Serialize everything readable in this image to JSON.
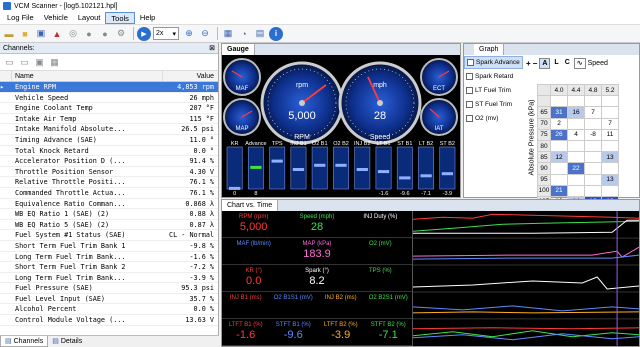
{
  "window": {
    "title": "VCM Scanner - [log5.102121.hpl]"
  },
  "menu": {
    "items": [
      "Log File",
      "Vehicle",
      "Layout",
      "Tools",
      "Help"
    ],
    "active": "Tools"
  },
  "toolbar": {
    "zoom": "2x"
  },
  "channels": {
    "title": "Channels:",
    "pin": " ✕",
    "col_name": "Name",
    "col_value": "Value",
    "rows": [
      {
        "name": "Engine RPM",
        "value": "4,853 rpm",
        "selected": true
      },
      {
        "name": "Vehicle Speed",
        "value": "26 mph"
      },
      {
        "name": "Engine Coolant Temp",
        "value": "207 °F"
      },
      {
        "name": "Intake Air Temp",
        "value": "115 °F"
      },
      {
        "name": "Intake Manifold Absolute...",
        "value": "26.5 psi"
      },
      {
        "name": "Timing Advance (SAE)",
        "value": "11.0 °"
      },
      {
        "name": "Total Knock Retard",
        "value": "0.0 °"
      },
      {
        "name": "Accelerator Position D (...",
        "value": "91.4 %"
      },
      {
        "name": "Throttle Position Sensor",
        "value": "4.30 V"
      },
      {
        "name": "Relative Throttle Positi...",
        "value": "76.1 %"
      },
      {
        "name": "Commanded Throttle Actua...",
        "value": "76.1 %"
      },
      {
        "name": "Equivalence Ratio Comman...",
        "value": "0.868 λ"
      },
      {
        "name": "WB EQ Ratio 1 (SAE) (2)",
        "value": "0.88 λ"
      },
      {
        "name": "WB EQ Ratio 5 (SAE) (2)",
        "value": "0.87 λ"
      },
      {
        "name": "Fuel System #1 Status (SAE)",
        "value": "CL - Normal"
      },
      {
        "name": "Short Term Fuel Trim Bank 1",
        "value": "-9.8 %"
      },
      {
        "name": "Long Term Fuel Trim Bank...",
        "value": "-1.6 %"
      },
      {
        "name": "Short Term Fuel Trim Bank 2",
        "value": "-7.2 %"
      },
      {
        "name": "Long Term Fuel Trim Bank...",
        "value": "-3.9 %"
      },
      {
        "name": "Fuel Pressure (SAE)",
        "value": "95.3 psi"
      },
      {
        "name": "Fuel Level Input (SAE)",
        "value": "35.7 %"
      },
      {
        "name": "Alcohol Percent",
        "value": "0.0 %"
      },
      {
        "name": "Control Module Voltage (...",
        "value": "13.63 V"
      }
    ]
  },
  "bottom_tabs": [
    "Channels",
    "Details"
  ],
  "gauge": {
    "tab": "Gauge",
    "rpm_label": "rpm",
    "rpm_value": "5,000",
    "rpm_caption": "RPM",
    "speed_label": "mph",
    "speed_value": "28",
    "speed_caption": "Speed",
    "small_left": [
      "MAF",
      "MAP"
    ],
    "small_right": [
      "ECT",
      "IAT"
    ],
    "bar_headers": [
      "KR",
      "Advance",
      "TPS",
      "INJ B1",
      "O2 B1",
      "O2 B2",
      "INJ B2",
      "LT B1",
      "ST B1",
      "LT B2",
      "ST B2"
    ],
    "bar_values": [
      "0",
      "8",
      "",
      "",
      "",
      "",
      "",
      "-1.6",
      "-9.6",
      "-7.1",
      "-3.9"
    ],
    "bar_levels": [
      0.05,
      0.55,
      0.7,
      0.5,
      0.6,
      0.6,
      0.5,
      0.45,
      0.3,
      0.35,
      0.4
    ]
  },
  "graph": {
    "tab": "Graph",
    "legend": [
      "Spark Advance",
      "Spark Retard",
      "LT Fuel Trim",
      "ST Fuel Trim",
      "O2 (mv)"
    ],
    "toolbar": [
      "+",
      "−",
      "A",
      "L",
      "C",
      "Speed"
    ],
    "y_label": "Absolute Pressure (kPa)",
    "col_headers": [
      "4.0",
      "4.4",
      "4.8",
      "5.2"
    ],
    "rows": [
      {
        "y": "",
        "cells": [
          "",
          "",
          "",
          ""
        ]
      },
      {
        "y": "65",
        "cells": [
          "31",
          "16",
          "7",
          ""
        ]
      },
      {
        "y": "70",
        "cells": [
          "2",
          "",
          "",
          "7"
        ]
      },
      {
        "y": "75",
        "cells": [
          "26",
          "4",
          "-8",
          "11"
        ]
      },
      {
        "y": "80",
        "cells": [
          "",
          "",
          "",
          ""
        ]
      },
      {
        "y": "85",
        "cells": [
          "12",
          "",
          "",
          "13"
        ]
      },
      {
        "y": "90",
        "cells": [
          "",
          "22",
          "",
          ""
        ]
      },
      {
        "y": "95",
        "cells": [
          "",
          "",
          "",
          "13"
        ]
      },
      {
        "y": "100",
        "cells": [
          "21",
          "",
          "",
          ""
        ]
      },
      {
        "y": "105",
        "cells": [
          "10",
          "14",
          "13",
          "13"
        ]
      }
    ]
  },
  "chart": {
    "tab": "Chart vs. Time",
    "lanes": [
      {
        "cells": [
          {
            "label": "RPM (rpm)",
            "value": "5,000",
            "color": "#ff3b3b"
          },
          {
            "label": "Speed (mph)",
            "value": "28",
            "color": "#3fe04a"
          },
          {
            "label": "INJ Duty (%)",
            "value": "",
            "color": "#ffffff"
          }
        ]
      },
      {
        "cells": [
          {
            "label": "MAF (lb/min)",
            "value": "",
            "color": "#5b8cff"
          },
          {
            "label": "MAP (kPa)",
            "value": "183.9",
            "color": "#ff6bd8"
          },
          {
            "label": "O2 (mV)",
            "value": "",
            "color": "#3fe04a"
          }
        ]
      },
      {
        "cells": [
          {
            "label": "KR (°)",
            "value": "0.0",
            "color": "#ff3b3b"
          },
          {
            "label": "Spark (°)",
            "value": "8.2",
            "color": "#ffffff"
          },
          {
            "label": "TPS (%)",
            "value": "",
            "color": "#3fe04a"
          }
        ]
      },
      {
        "cells": [
          {
            "label": "INJ B1 (ms)",
            "value": "",
            "color": "#ff3b3b"
          },
          {
            "label": "O2 B1S1 (mV)",
            "value": "",
            "color": "#5b8cff"
          },
          {
            "label": "INJ B2 (ms)",
            "value": "",
            "color": "#ffb020"
          },
          {
            "label": "O2 B2S1 (mV)",
            "value": "",
            "color": "#3fe04a"
          }
        ]
      },
      {
        "cells": [
          {
            "label": "LTFT B1 (%)",
            "value": "-1.6",
            "color": "#ff3b3b"
          },
          {
            "label": "STFT B1 (%)",
            "value": "-9.6",
            "color": "#5b8cff"
          },
          {
            "label": "LTFT B2 (%)",
            "value": "-3.9",
            "color": "#ffb020"
          },
          {
            "label": "STFT B2 (%)",
            "value": "-7.1",
            "color": "#3fe04a"
          }
        ]
      }
    ]
  }
}
